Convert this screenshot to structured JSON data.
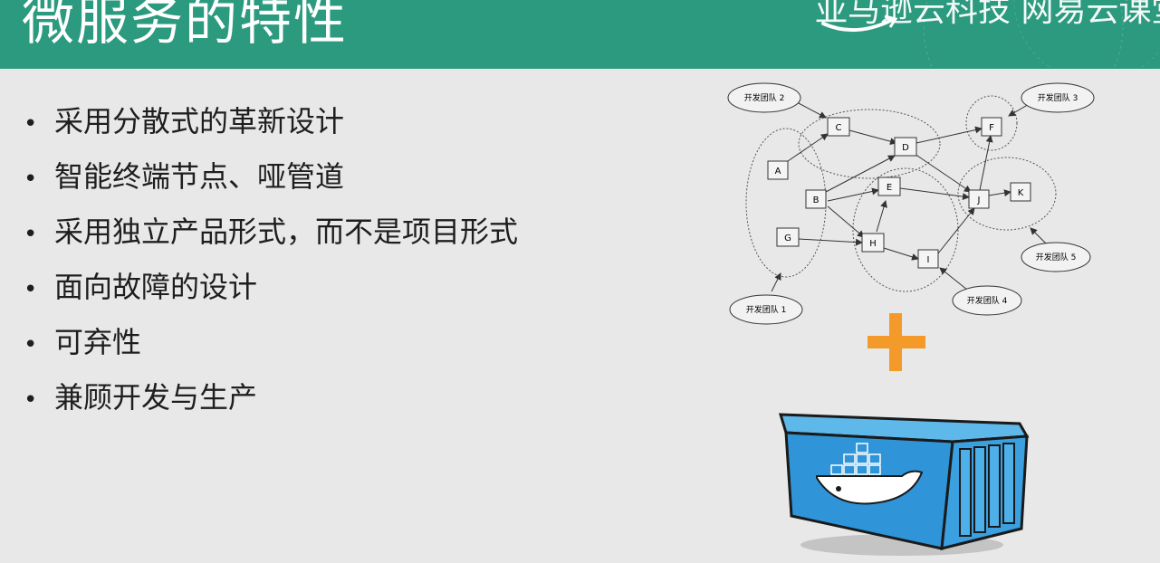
{
  "slide": {
    "title": "微服务的特性",
    "logo_text": "亚马逊云科技 网易云课堂",
    "bullets": [
      "采用分散式的革新设计",
      "智能终端节点、哑管道",
      "采用独立产品形式，而不是项目形式",
      "面向故障的设计",
      "可弃性",
      "兼顾开发与生产"
    ]
  },
  "diagram": {
    "nodes": [
      "A",
      "B",
      "C",
      "D",
      "E",
      "F",
      "G",
      "H",
      "I",
      "J",
      "K"
    ],
    "teams": [
      "开发团队 1",
      "开发团队 2",
      "开发团队 3",
      "开发团队 4",
      "开发团队 5"
    ]
  },
  "colors": {
    "header": "#2b9a7e",
    "background": "#e8e8e8",
    "plus": "#f39a2a",
    "container": "#3a9bd9"
  },
  "icons": {
    "plus": "plus-icon",
    "docker": "docker-container-icon"
  }
}
